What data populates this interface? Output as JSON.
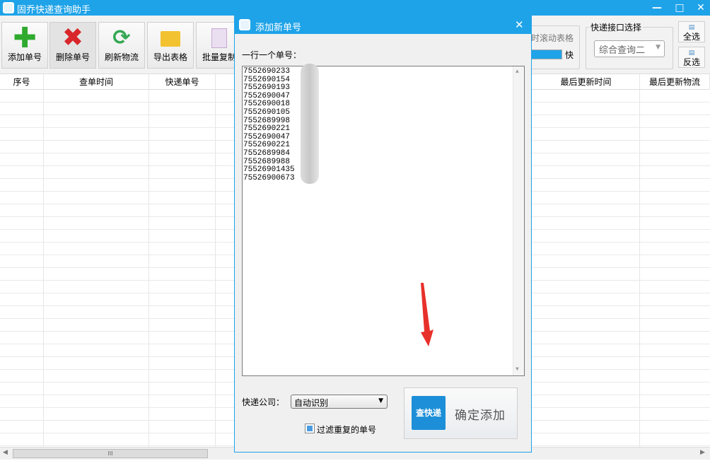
{
  "window": {
    "title": "固乔快递查询助手",
    "minimize": "—",
    "maximize": "□",
    "close": "✕"
  },
  "toolbar": {
    "buttons": [
      {
        "label": "添加单号",
        "icon": "plus-icon",
        "color": "#2faa2f"
      },
      {
        "label": "删除单号",
        "icon": "delete-x-icon",
        "color": "#d9262b"
      },
      {
        "label": "刷新物流",
        "icon": "refresh-icon",
        "color": "#34a853"
      },
      {
        "label": "导出表格",
        "icon": "folder-export-icon",
        "color": "#f2c230"
      },
      {
        "label": "批量复制",
        "icon": "copy-icon",
        "color": "#c9a7d4"
      }
    ],
    "scroll_label": "时滚动表格",
    "speed_label": "快",
    "api_group_label": "快递接口选择",
    "api_selected": "综合查询二",
    "select_all": "全选",
    "invert_select": "反选"
  },
  "table": {
    "columns": [
      "序号",
      "查单时间",
      "快递单号",
      "最后更新时间",
      "最后更新物流"
    ]
  },
  "dialog": {
    "title": "添加新单号",
    "close": "✕",
    "instruction": "一行一个单号：",
    "numbers": [
      "7552690233",
      "7552690154",
      "7552690193",
      "7552690047",
      "7552690018",
      "7552690105",
      "7552689998",
      "7552690221",
      "7552690047",
      "7552690221",
      "7552689984",
      "7552689988",
      "75526901435",
      "75526900673"
    ],
    "company_label": "快递公司：",
    "company_selected": "自动识别",
    "filter_label": "过滤重复的单号",
    "filter_checked": true,
    "logo_text": "查快递",
    "confirm_label": "确定添加"
  },
  "scrollbar": {
    "grip": "III"
  },
  "colors": {
    "accent": "#1fa3e8",
    "arrow": "#e8302a"
  }
}
